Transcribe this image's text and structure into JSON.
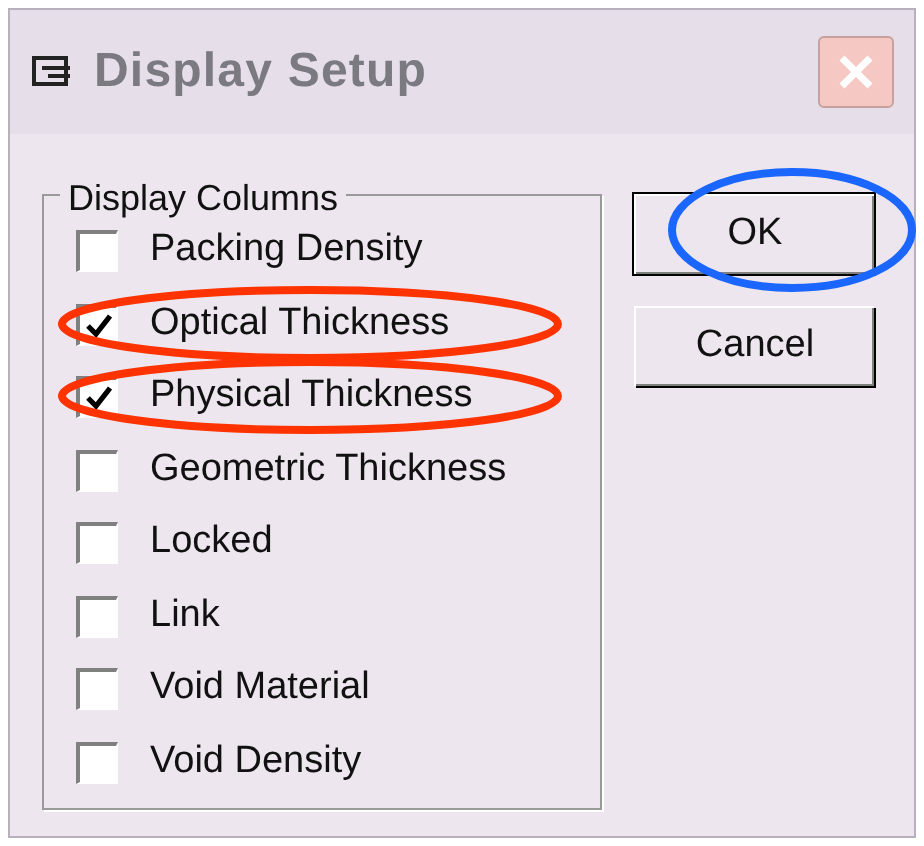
{
  "window": {
    "title": "Display Setup"
  },
  "group": {
    "title": "Display Columns"
  },
  "columns": [
    {
      "label": "Packing Density",
      "checked": false,
      "circled": false
    },
    {
      "label": "Optical Thickness",
      "checked": true,
      "circled": true
    },
    {
      "label": "Physical Thickness",
      "checked": true,
      "circled": true
    },
    {
      "label": "Geometric Thickness",
      "checked": false,
      "circled": false
    },
    {
      "label": "Locked",
      "checked": false,
      "circled": false
    },
    {
      "label": "Link",
      "checked": false,
      "circled": false
    },
    {
      "label": "Void Material",
      "checked": false,
      "circled": false
    },
    {
      "label": "Void Density",
      "checked": false,
      "circled": false
    }
  ],
  "buttons": [
    {
      "label": "OK",
      "default": true,
      "circled": true
    },
    {
      "label": "Cancel",
      "default": false,
      "circled": false
    }
  ]
}
